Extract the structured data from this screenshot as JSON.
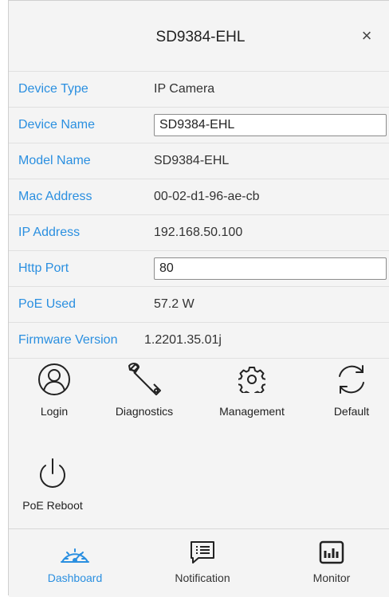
{
  "header": {
    "title": "SD9384-EHL",
    "close_symbol": "×"
  },
  "fields": {
    "device_type": {
      "label": "Device Type",
      "value": "IP Camera"
    },
    "device_name": {
      "label": "Device Name",
      "value": "SD9384-EHL"
    },
    "model_name": {
      "label": "Model Name",
      "value": "SD9384-EHL"
    },
    "mac_address": {
      "label": "Mac Address",
      "value": "00-02-d1-96-ae-cb"
    },
    "ip_address": {
      "label": "IP Address",
      "value": "192.168.50.100"
    },
    "http_port": {
      "label": "Http Port",
      "value": "80"
    },
    "poe_used": {
      "label": "PoE Used",
      "value": "57.2 W"
    },
    "firmware_version": {
      "label": "Firmware Version",
      "value": "1.2201.35.01j"
    }
  },
  "actions": {
    "login": {
      "label": "Login",
      "icon": "user-circle-icon"
    },
    "diagnostics": {
      "label": "Diagnostics",
      "icon": "wrench-icon"
    },
    "management": {
      "label": "Management",
      "icon": "gear-icon"
    },
    "default": {
      "label": "Default",
      "icon": "refresh-icon"
    },
    "poe_reboot": {
      "label": "PoE Reboot",
      "icon": "power-icon"
    }
  },
  "tabs": {
    "dashboard": {
      "label": "Dashboard",
      "icon": "gauge-icon",
      "active": true
    },
    "notification": {
      "label": "Notification",
      "icon": "message-icon",
      "active": false
    },
    "monitor": {
      "label": "Monitor",
      "icon": "chart-monitor-icon",
      "active": false
    }
  },
  "colors": {
    "accent": "#2a8fe0",
    "background": "#f4f4f4",
    "text": "#333333"
  }
}
